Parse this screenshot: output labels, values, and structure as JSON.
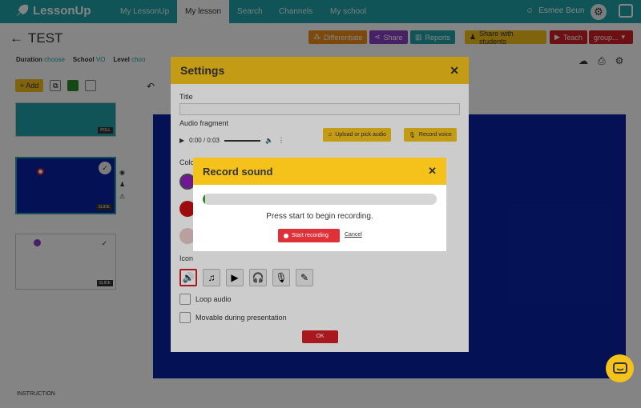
{
  "topbar": {
    "brand": "LessonUp",
    "tabs": [
      "My LessonUp",
      "My lesson",
      "Search",
      "Channels",
      "My school"
    ],
    "user_name": "Esmee Beun"
  },
  "lesson": {
    "title": "TEST",
    "toolbar": {
      "differentiate": "Differentiate",
      "share": "Share",
      "reports": "Reports",
      "share_students": "Share with students",
      "teach": "Teach",
      "group": "group..."
    },
    "meta": {
      "duration_label": "Duration",
      "duration_value": "choose",
      "school_label": "School",
      "school_value": "VO",
      "level_label": "Level",
      "level_value": "choo"
    },
    "add_label": "Add"
  },
  "slides": [
    {
      "badge": "POLL"
    },
    {
      "badge": "SLIDE"
    },
    {
      "badge": "SLIDE"
    }
  ],
  "instruction_label": "INSTRUCTION",
  "settings": {
    "title": "Settings",
    "title_field_label": "Title",
    "title_value": "",
    "audio_label": "Audio fragment",
    "audio_time": "0:00 / 0:03",
    "upload_button": "Upload or pick audio",
    "record_button": "Record voice",
    "color_label": "Colo",
    "icon_label": "Icon",
    "loop_label": "Loop audio",
    "movable_label": "Movable during presentation",
    "ok_button": "OK"
  },
  "record_dialog": {
    "title": "Record sound",
    "progress": 0.01,
    "message": "Press start to begin recording.",
    "start_button": "Start recording",
    "cancel_link": "Cancel"
  },
  "colors": {
    "teal": "#1fa2a8",
    "yellow": "#f4c21b",
    "red": "#e03038",
    "stage_blue": "#0a23a3"
  }
}
